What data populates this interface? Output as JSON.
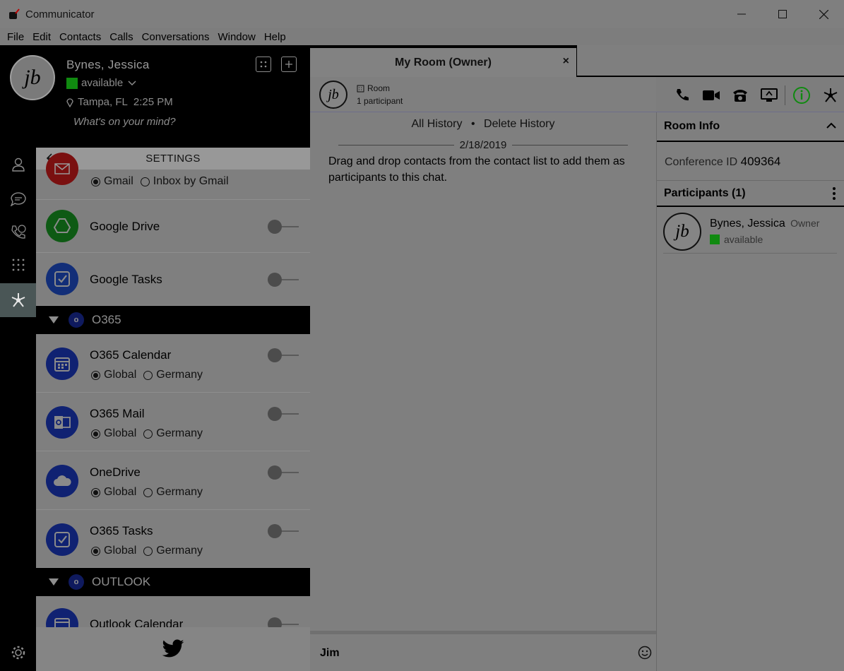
{
  "window": {
    "title": "Communicator"
  },
  "menu": [
    "File",
    "Edit",
    "Contacts",
    "Calls",
    "Conversations",
    "Window",
    "Help"
  ],
  "profile": {
    "initials": "jb",
    "name": "Bynes, Jessica",
    "status": "available",
    "location": "Tampa, FL",
    "time": "2:25 PM",
    "mind_placeholder": "What's on your mind?",
    "status_color": "#108a10"
  },
  "settings": {
    "title": "SETTINGS",
    "gmail_options": [
      "Gmail",
      "Inbox by Gmail"
    ],
    "google_drive": "Google Drive",
    "google_tasks": "Google Tasks",
    "group_o365": "O365",
    "o365_calendar": "O365 Calendar",
    "o365_mail": "O365 Mail",
    "onedrive": "OneDrive",
    "o365_tasks": "O365 Tasks",
    "region_options": [
      "Global",
      "Germany"
    ],
    "group_outlook": "OUTLOOK",
    "outlook_calendar": "Outlook Calendar"
  },
  "chat": {
    "tab_title": "My Room (Owner)",
    "tab_close": "×",
    "room_label": "Room",
    "participant_count": "1 participant",
    "all_history": "All History",
    "separator": "•",
    "delete_history": "Delete History",
    "date": "2/18/2019",
    "message": "Drag and drop contacts from the contact list to add them as participants to this chat.",
    "composer_text": "Jim"
  },
  "room_info": {
    "title": "Room Info",
    "conference_label": "Conference ID",
    "conference_id": "409364",
    "participants_label": "Participants (1)",
    "participant": {
      "initials": "jb",
      "name": "Bynes, Jessica",
      "role": "Owner",
      "status": "available"
    }
  },
  "colors": {
    "accent_green": "#108a10",
    "o365_blue": "#0f1a5e"
  }
}
